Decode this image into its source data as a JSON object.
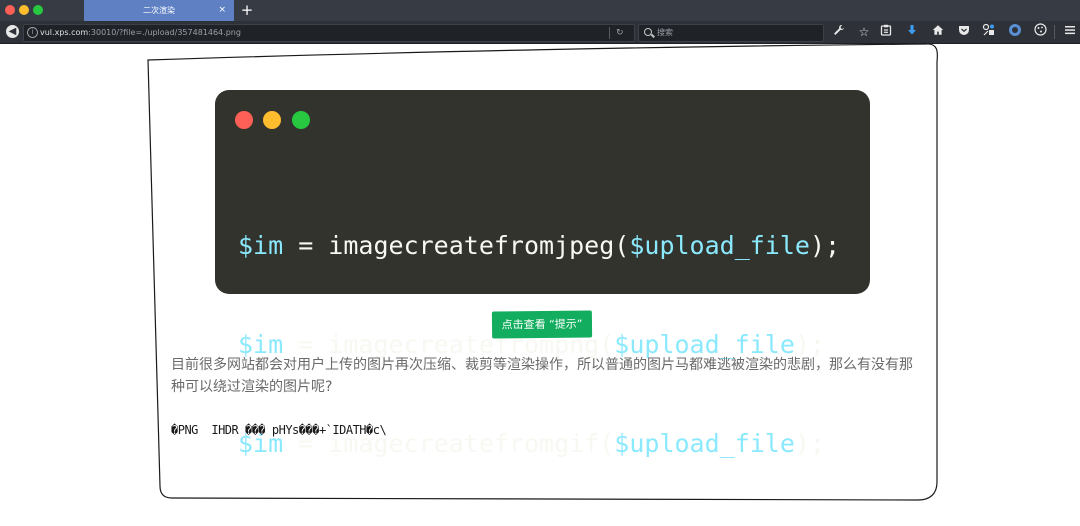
{
  "browser": {
    "tab_title": "二次渲染",
    "tab_close": "×",
    "new_tab": "+",
    "url_host": "vul.xps.com",
    "url_rest": ":30010/?file=./upload/357481464.png",
    "search_placeholder": "搜索"
  },
  "toolbar_icons": [
    "wrench-icon",
    "star-icon",
    "reading-list-icon",
    "download-icon",
    "home-icon",
    "pocket-icon",
    "extension-icon",
    "ublock-icon",
    "cookie-icon",
    "menu-icon"
  ],
  "code_block": {
    "lines": [
      {
        "var": "$im",
        "op": " = imagecreatefromjpeg(",
        "arg": "$upload_file",
        "end": ");"
      },
      {
        "var": "$im",
        "op": " = imagecreatefrompng(",
        "arg": "$upload_file",
        "end": ");"
      },
      {
        "var": "$im",
        "op": " = imagecreatefromgif(",
        "arg": "$upload_file",
        "end": ");"
      }
    ]
  },
  "hint_button": "点击查看 “提示”",
  "description": "目前很多网站都会对用户上传的图片再次压缩、裁剪等渲染操作，所以普通的图片马都难逃被渲染的悲剧，那么有没有那种可以绕过渲染的图片呢?",
  "png_output": "�PNG  IHDR ��� pHYs���+`IDATH�c\\"
}
